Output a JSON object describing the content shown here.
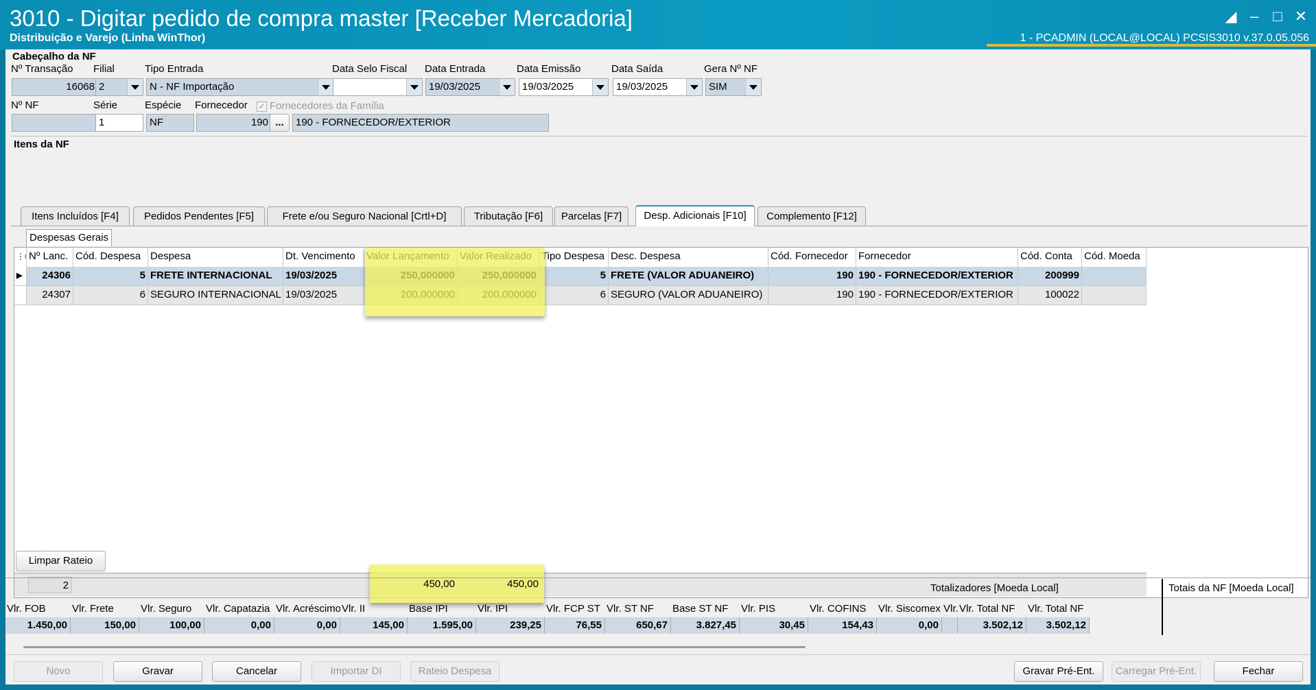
{
  "window": {
    "title": "3010 - Digitar pedido de compra master [Receber Mercadoria]",
    "subtitle": "Distribuição e Varejo (Linha WinThor)",
    "status": "1 - PCADMIN (LOCAL@LOCAL)   PCSIS3010  v.37.0.05.056"
  },
  "header": {
    "section_title": "Cabeçalho da NF",
    "labels": {
      "transacao": "Nº Transação",
      "filial": "Filial",
      "tipo_entrada": "Tipo Entrada",
      "data_selo": "Data Selo Fiscal",
      "data_entrada": "Data Entrada",
      "data_emissao": "Data Emissão",
      "data_saida": "Data Saída",
      "gera_nf": "Gera Nº NF",
      "num_nf": "Nº NF",
      "serie": "Série",
      "especie": "Espécie",
      "fornecedor": "Fornecedor",
      "fornecedores_familia": "Fornecedores da Família"
    },
    "values": {
      "transacao": "16068",
      "filial": "2",
      "tipo_entrada": "N - NF Importação",
      "data_selo": "",
      "data_entrada": "19/03/2025",
      "data_emissao": "19/03/2025",
      "data_saida": "19/03/2025",
      "gera_nf": "SIM",
      "num_nf": "",
      "serie": "1",
      "especie": "NF",
      "fornecedor_cod": "190",
      "fornecedor_btn": "...",
      "fornecedor_nome": "190 - FORNECEDOR/EXTERIOR"
    }
  },
  "items": {
    "section_title": "Itens da NF",
    "tabs": [
      "Itens Incluídos [F4]",
      "Pedidos Pendentes [F5]",
      "Frete e/ou Seguro Nacional [Crtl+D]",
      "Tributação [F6]",
      "Parcelas [F7]",
      "Desp. Adicionais [F10]",
      "Complemento [F12]"
    ],
    "subtab": "Despesas Gerais",
    "columns": [
      "Nº Lanc.",
      "Cód. Despesa",
      "Despesa",
      "Dt. Vencimento",
      "Valor Lançamento",
      "Valor Realizado",
      "Tipo Despesa",
      "Desc. Despesa",
      "Cód. Fornecedor",
      "Fornecedor",
      "Cód. Conta",
      "Cód. Moeda"
    ],
    "rows": [
      [
        "24306",
        "5",
        "FRETE INTERNACIONAL",
        "19/03/2025",
        "250,000000",
        "250,000000",
        "5",
        "FRETE (VALOR ADUANEIRO)",
        "190",
        "190 - FORNECEDOR/EXTERIOR",
        "200999",
        ""
      ],
      [
        "24307",
        "6",
        "SEGURO INTERNACIONAL",
        "19/03/2025",
        "200,000000",
        "200,000000",
        "6",
        "SEGURO (VALOR ADUANEIRO)",
        "190",
        "190 - FORNECEDOR/EXTERIOR",
        "100022",
        ""
      ]
    ],
    "footer": {
      "count": "2",
      "valor_lancamento": "450,00",
      "valor_realizado": "450,00"
    },
    "limpar_rateio": "Limpar Rateio"
  },
  "totals": {
    "group_left": "Totalizadores [Moeda Local]",
    "group_right": "Totais da NF [Moeda Local]",
    "headers": [
      "Vlr. FOB",
      "Vlr. Frete",
      "Vlr. Seguro",
      "Vlr. Capatazia",
      "Vlr. Acréscimo",
      "Vlr. II",
      "Base IPI",
      "Vlr. IPI",
      "Vlr. FCP ST",
      "Vlr. ST NF",
      "Base ST NF",
      "Vlr. PIS",
      "Vlr. COFINS",
      "Vlr. Siscomex",
      "Vlr. A",
      "Vlr. Total NF",
      "Vlr. Total NF"
    ],
    "values": [
      "1.450,00",
      "150,00",
      "100,00",
      "0,00",
      "0,00",
      "145,00",
      "1.595,00",
      "239,25",
      "76,55",
      "650,67",
      "3.827,45",
      "30,45",
      "154,43",
      "0,00",
      "",
      "3.502,12",
      "3.502,12"
    ]
  },
  "buttons": {
    "novo": "Novo",
    "gravar": "Gravar",
    "cancelar": "Cancelar",
    "importar_di": "Importar DI",
    "rateio": "Rateio Despesa",
    "gravar_pre": "Gravar Pré-Ent.",
    "carregar_pre": "Carregar Pré-Ent.",
    "fechar": "Fechar"
  }
}
